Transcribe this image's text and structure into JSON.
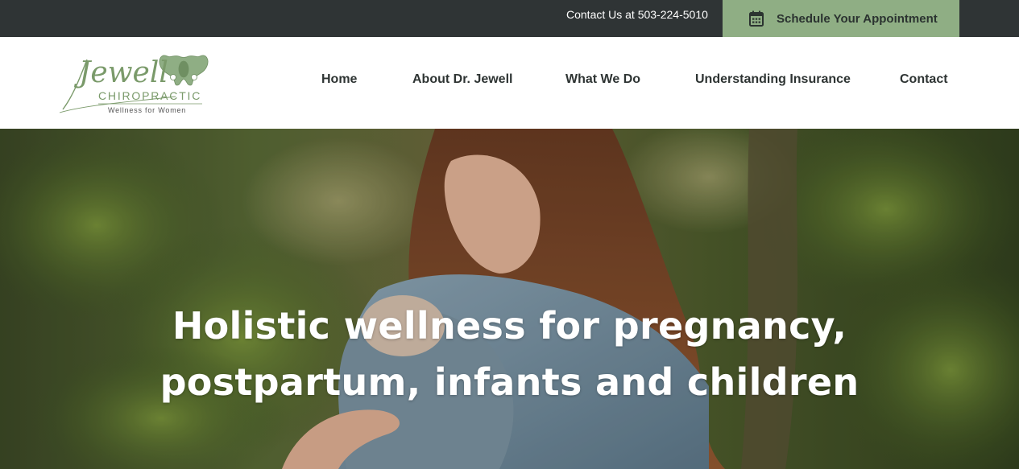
{
  "topbar": {
    "contact_text": "Contact Us at 503-224-5010",
    "appointment_label": "Schedule Your Appointment",
    "appointment_icon": "calendar-icon",
    "background_color": "#2f3435",
    "appointment_color": "#8fae84"
  },
  "logo": {
    "wordmark": "Jewell",
    "subtitle": "CHIROPRACTIC",
    "tagline": "Wellness for Women",
    "icon": "pelvis-icon",
    "color": "#7a9a6a"
  },
  "nav": {
    "items": [
      {
        "label": "Home"
      },
      {
        "label": "About Dr. Jewell"
      },
      {
        "label": "What We Do"
      },
      {
        "label": "Understanding Insurance"
      },
      {
        "label": "Contact"
      }
    ]
  },
  "hero": {
    "headline_line1": "Holistic wellness for pregnancy,",
    "headline_line2": "postpartum, infants and children",
    "image_description": "mother-holding-baby-photo"
  }
}
